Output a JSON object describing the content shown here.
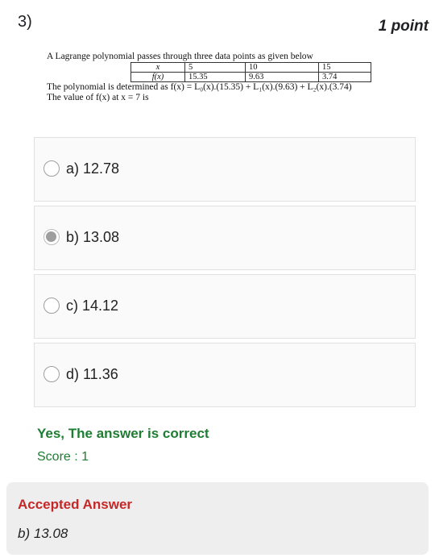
{
  "question_number": "3)",
  "points": "1 point",
  "question": {
    "intro": "A Lagrange polynomial passes through three data points as given below",
    "table": {
      "row_x_label": "x",
      "x_values": [
        "5",
        "10",
        "15"
      ],
      "row_f_label": "f(x)",
      "f_values": [
        "15.35",
        "9.63",
        "3.74"
      ]
    },
    "polynomial": "The polynomial is determined as f(x) = L₀(x).(15.35) + L₁(x).(9.63) + L₂(x).(3.74)",
    "ask": "The value of f(x) at x = 7 is"
  },
  "options": [
    {
      "label": "a) 12.78",
      "selected": false
    },
    {
      "label": "b) 13.08",
      "selected": true
    },
    {
      "label": "c) 14.12",
      "selected": false
    },
    {
      "label": "d) 11.36",
      "selected": false
    }
  ],
  "feedback": "Yes, The answer is correct",
  "score": "Score : 1",
  "accepted_title": "Accepted Answer",
  "accepted_answer": "b) 13.08"
}
